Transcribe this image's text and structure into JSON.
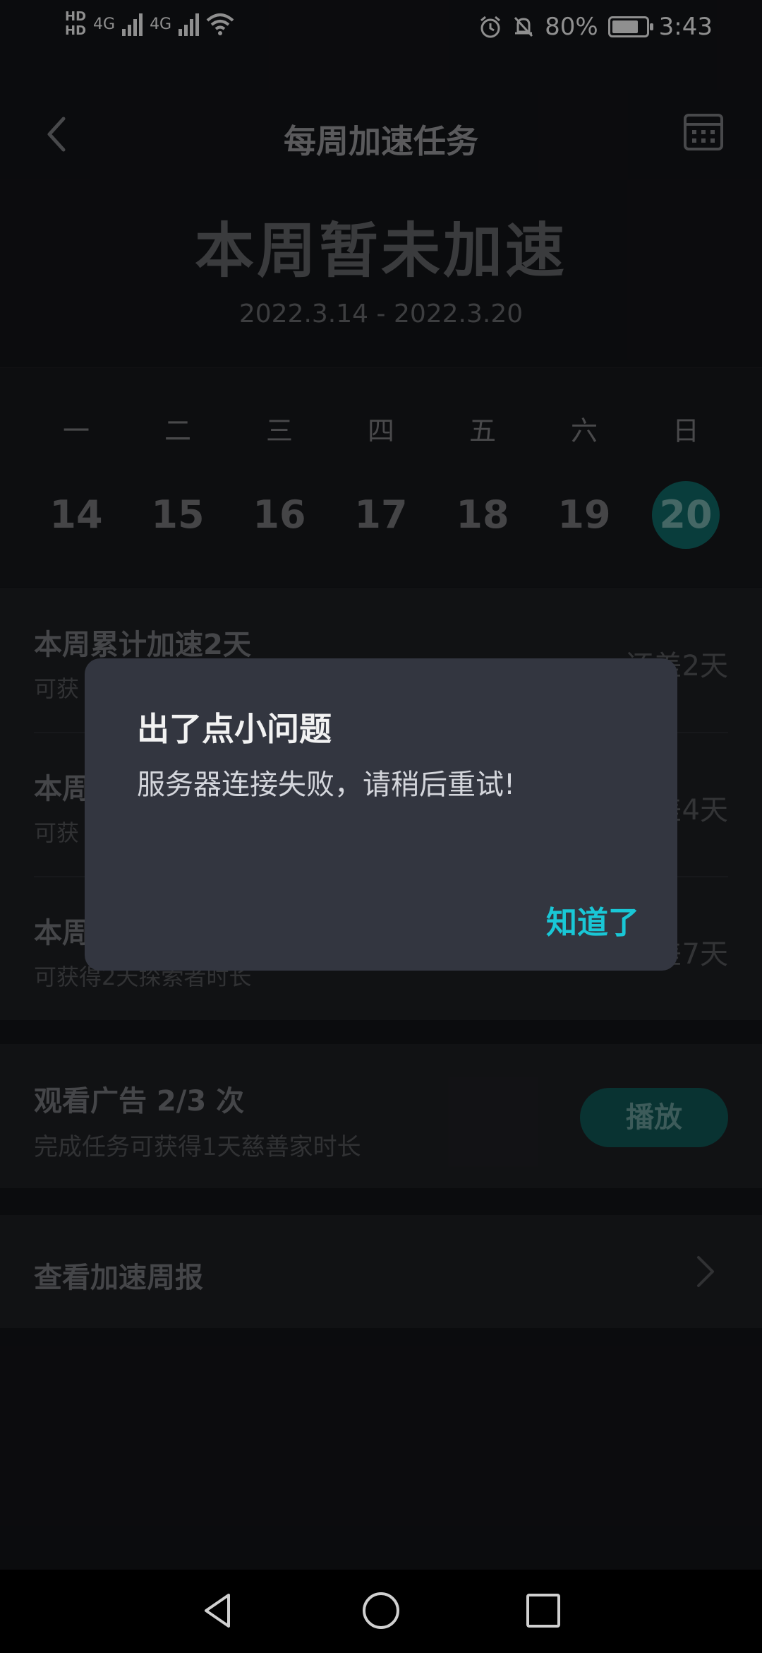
{
  "status_bar": {
    "hd1": "HD",
    "hd2": "HD",
    "net1": "4G",
    "net2": "4G",
    "battery_percent": "80%",
    "battery_level": 0.8,
    "time": "3:43"
  },
  "header": {
    "title": "每周加速任务"
  },
  "week": {
    "status": "本周暂未加速",
    "range": "2022.3.14 - 2022.3.20"
  },
  "calendar": {
    "weekdays": [
      "一",
      "二",
      "三",
      "四",
      "五",
      "六",
      "日"
    ],
    "days": [
      "14",
      "15",
      "16",
      "17",
      "18",
      "19",
      "20"
    ],
    "selected_index": 6
  },
  "tasks": [
    {
      "title": "本周累计加速2天",
      "subtitle": "可获",
      "right": "还差2天"
    },
    {
      "title": "本周",
      "subtitle": "可获",
      "right": "差4天"
    },
    {
      "title": "本周",
      "subtitle": "可获得2天探索者时长",
      "right": "差7天"
    }
  ],
  "ad_task": {
    "title": "观看广告 2/3 次",
    "subtitle": "完成任务可获得1天慈善家时长",
    "button": "播放"
  },
  "report": {
    "label": "查看加速周报"
  },
  "dialog": {
    "title": "出了点小问题",
    "message": "服务器连接失败，请稍后重试!",
    "confirm": "知道了"
  },
  "colors": {
    "accent": "#19c7d6",
    "selected_day": "#0f5f5c",
    "dialog_bg": "#333640"
  }
}
